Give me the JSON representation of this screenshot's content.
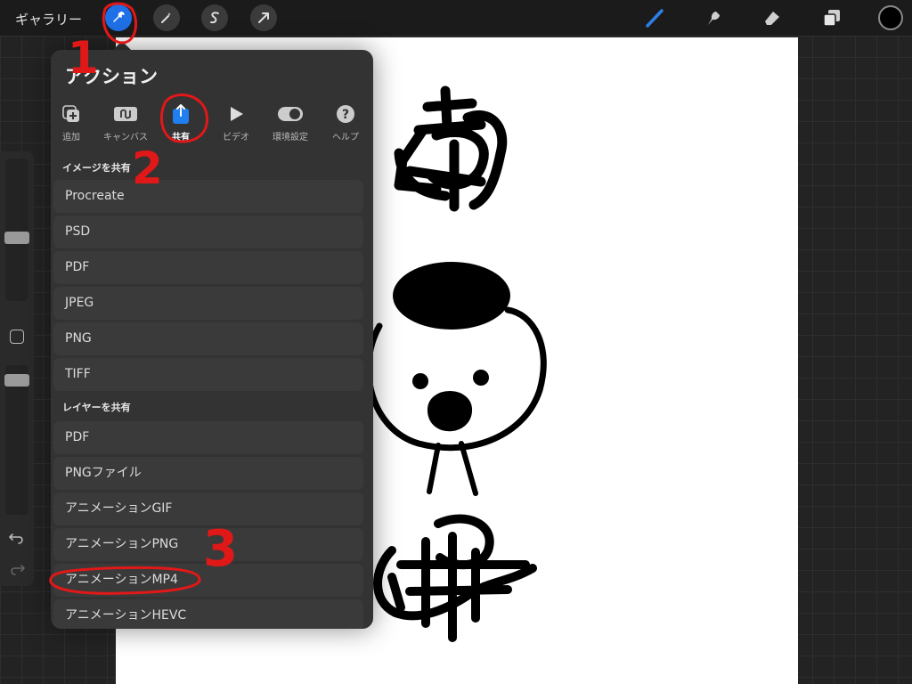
{
  "topbar": {
    "gallery_label": "ギャラリー",
    "tools_left": [
      "wrench-icon",
      "magic-wand-icon",
      "selection-s-icon",
      "transform-arrow-icon"
    ],
    "tools_right": [
      "brush-icon",
      "smudge-icon",
      "eraser-icon",
      "layers-icon"
    ],
    "color": "#000000",
    "accent": "#1f6fe6"
  },
  "panel": {
    "title": "アクション",
    "tabs": [
      {
        "label": "追加",
        "icon": "add-image-icon"
      },
      {
        "label": "キャンバス",
        "icon": "canvas-icon"
      },
      {
        "label": "共有",
        "icon": "share-icon"
      },
      {
        "label": "ビデオ",
        "icon": "play-icon"
      },
      {
        "label": "環境設定",
        "icon": "toggle-icon"
      },
      {
        "label": "ヘルプ",
        "icon": "help-icon"
      }
    ],
    "active_tab": "共有",
    "share_image_heading": "イメージを共有",
    "share_image_items": [
      "Procreate",
      "PSD",
      "PDF",
      "JPEG",
      "PNG",
      "TIFF"
    ],
    "share_layer_heading": "レイヤーを共有",
    "share_layer_items": [
      "PDF",
      "PNGファイル",
      "アニメーションGIF",
      "アニメーションPNG",
      "アニメーションMP4",
      "アニメーションHEVC"
    ]
  },
  "annotations": {
    "step1": "1",
    "step2": "2",
    "step3": "3",
    "color": "#e11818"
  }
}
